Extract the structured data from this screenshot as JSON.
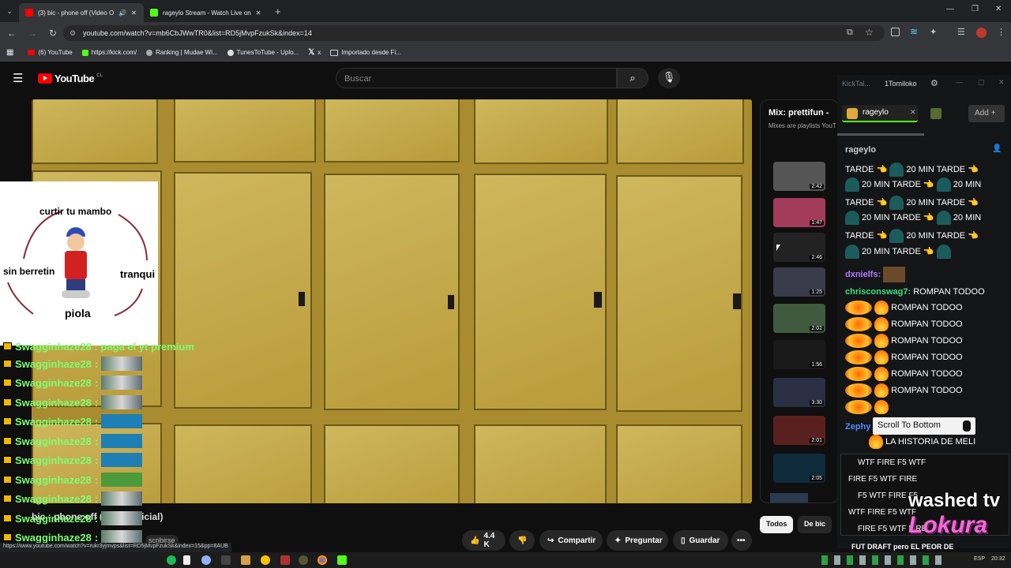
{
  "browser": {
    "tabs": [
      {
        "label": "(3) bic - phone off (Video O",
        "active": true
      },
      {
        "label": "rageylo Stream - Watch Live on",
        "active": false
      }
    ],
    "url": "youtube.com/watch?v=mb6CbJWwTR0&list=RD5jMvpFzukSk&index=14",
    "status_url": "https://www.youtube.com/watch?v=rukr3yjmvps&list=RD5jMvpFzukSk&index=15&pp=8AUB",
    "bookmarks": [
      "(6) YouTube",
      "https://kick.com/",
      "Ranking | Mudae Wi...",
      "TunesToTube - Uplo...",
      "x",
      "Importado desde Fi..."
    ]
  },
  "youtube": {
    "logo": "YouTube",
    "country": "CL",
    "search_placeholder": "Buscar",
    "playlist_title": "Mix: prettifun -",
    "playlist_sub": "Mixes are playlists YouT",
    "durations": [
      "2:42",
      "1:47",
      "2:46",
      "1:25",
      "2:02",
      "1:56",
      "3:30",
      "2:01",
      "2:05"
    ],
    "video_title_fragment": "bic - phone off (Video Oficial)",
    "subscribe_fragment": "scribirse",
    "likes": "4.4 K",
    "share": "Compartir",
    "ask": "Preguntar",
    "save": "Guardar",
    "chip_all": "Todos",
    "chip_bic": "De bic"
  },
  "meme": {
    "top": "curtir tu mambo",
    "left": "sin berretin",
    "right": "tranqui",
    "bottom": "piola"
  },
  "left_chat": {
    "top_line": "Swagginhaze28 : paga el yt premium",
    "username": "Swagginhaze28",
    "sep": ":",
    "row_count": 12
  },
  "kick": {
    "tab1": "KickTal...",
    "tab2": "1Tomiloko",
    "channel_chip": "rageylo",
    "add_label": "Add",
    "channel_header": "rageylo",
    "tarde": "20 MIN TARDE",
    "tarde_word": "TARDE",
    "min20": "20 MIN",
    "user1": "dxnielfs:",
    "user2": "chrisconswag7:",
    "rompan": "ROMPAN TODOO",
    "user3": "Zephy",
    "meli": "LA HISTORIA DE MELI",
    "scroll_btn": "Scroll To Bottom",
    "wtf_lines": [
      "WTF  FIRE  F5 WTF",
      "FIRE  F5 WTF  FIRE",
      "F5 WTF  FIRE  F5",
      "WTF  FIRE  F5 WTF",
      "FIRE  F5 WTF  FIRE"
    ],
    "bottom_text": "FUT DRAFT pero EL PEOR DE",
    "overlay1": "washed tv",
    "overlay2": "Lokura"
  },
  "taskbar": {
    "lang": "ESP",
    "time": "20:32"
  }
}
